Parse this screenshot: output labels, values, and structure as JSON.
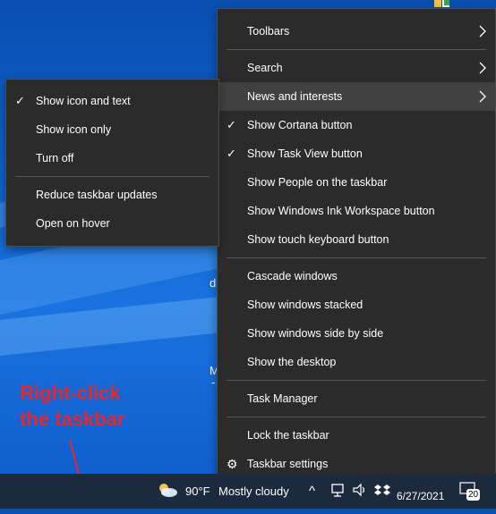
{
  "annotation": {
    "line1": "Right-click",
    "line2": "the taskbar"
  },
  "desktop_fragments": {
    "frag1": "d",
    "frag2": "M",
    "frag3": "-"
  },
  "context_menu": {
    "toolbars": "Toolbars",
    "search": "Search",
    "news": "News and interests",
    "cortana": "Show Cortana button",
    "taskview": "Show Task View button",
    "people": "Show People on the taskbar",
    "ink": "Show Windows Ink Workspace button",
    "touch_keyboard": "Show touch keyboard button",
    "cascade": "Cascade windows",
    "stacked": "Show windows stacked",
    "side_by_side": "Show windows side by side",
    "desktop": "Show the desktop",
    "task_manager": "Task Manager",
    "lock": "Lock the taskbar",
    "settings": "Taskbar settings",
    "check_glyph": "✓",
    "chevron_glyph": "›",
    "settings_glyph": "⚙"
  },
  "submenu": {
    "icon_and_text": "Show icon and text",
    "icon_only": "Show icon only",
    "turn_off": "Turn off",
    "reduce_updates": "Reduce taskbar updates",
    "open_on_hover": "Open on hover"
  },
  "taskbar": {
    "temperature": "90°F",
    "condition": "Mostly cloudy",
    "up_arrow": "^",
    "date": "6/27/2021",
    "notification_count": "20"
  },
  "icons": {
    "weather": "cloudy-weather-icon",
    "network": "network-icon",
    "volume": "volume-icon",
    "dropbox": "dropbox-icon",
    "notification": "action-center-icon"
  },
  "colors": {
    "annotation": "#e8262b",
    "menu_bg": "#2b2b2b",
    "highlight": "#414141",
    "taskbar_bg": "#1c2a3e"
  }
}
